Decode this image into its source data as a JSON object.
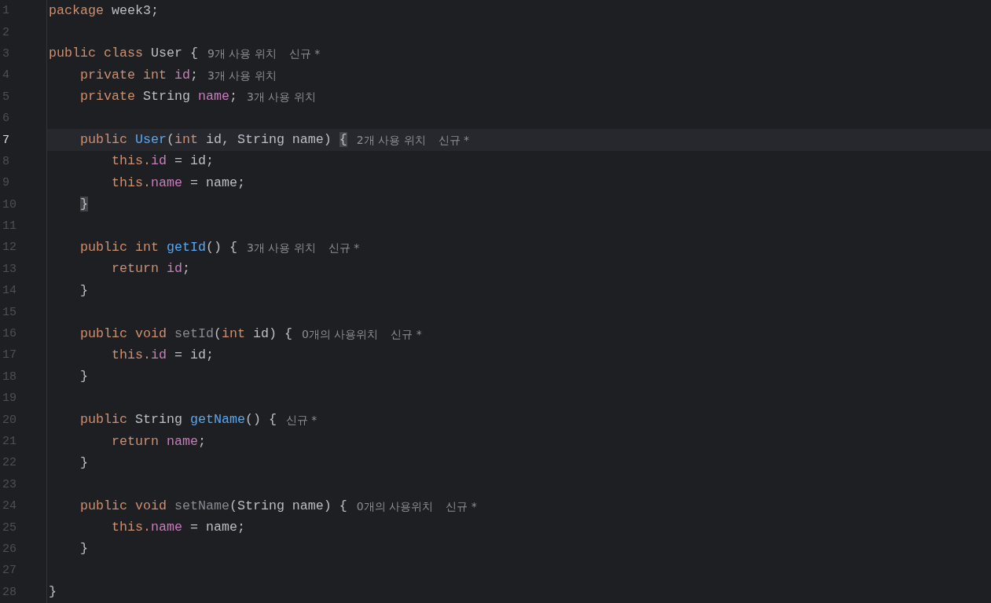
{
  "editor": {
    "lines": [
      {
        "number": "1",
        "current": false,
        "tokens": [
          {
            "kind": "keyword",
            "text": "package "
          },
          {
            "kind": "plain",
            "text": "week3;"
          }
        ]
      },
      {
        "number": "2",
        "current": false
      },
      {
        "number": "3",
        "current": false,
        "tokens": [
          {
            "kind": "keyword",
            "text": "public class "
          },
          {
            "kind": "plain",
            "text": "User {"
          }
        ],
        "hints": [
          "9개 사용 위치",
          "신규 *"
        ]
      },
      {
        "number": "4",
        "current": false,
        "tokens": [
          {
            "kind": "keyword",
            "text": "    private int "
          },
          {
            "kind": "field",
            "text": "id"
          },
          {
            "kind": "plain",
            "text": ";"
          }
        ],
        "hints": [
          "3개 사용 위치"
        ]
      },
      {
        "number": "5",
        "current": false,
        "tokens": [
          {
            "kind": "keyword",
            "text": "    private "
          },
          {
            "kind": "plain",
            "text": "String "
          },
          {
            "kind": "field",
            "text": "name"
          },
          {
            "kind": "plain",
            "text": ";"
          }
        ],
        "hints": [
          "3개 사용 위치"
        ]
      },
      {
        "number": "6",
        "current": false
      },
      {
        "number": "7",
        "current": true,
        "tokens": [
          {
            "kind": "keyword",
            "text": "    public "
          },
          {
            "kind": "method",
            "text": "User"
          },
          {
            "kind": "plain",
            "text": "("
          },
          {
            "kind": "keyword",
            "text": "int "
          },
          {
            "kind": "plain",
            "text": "id, String name) "
          },
          {
            "kind": "match",
            "text": "{"
          }
        ],
        "hints": [
          "2개 사용 위치",
          "신규 *"
        ]
      },
      {
        "number": "8",
        "current": false,
        "tokens": [
          {
            "kind": "keyword",
            "text": "        this."
          },
          {
            "kind": "field",
            "text": "id"
          },
          {
            "kind": "plain",
            "text": " = id;"
          }
        ]
      },
      {
        "number": "9",
        "current": false,
        "tokens": [
          {
            "kind": "keyword",
            "text": "        this."
          },
          {
            "kind": "field",
            "text": "name"
          },
          {
            "kind": "plain",
            "text": " = name;"
          }
        ]
      },
      {
        "number": "10",
        "current": false,
        "nested": true,
        "tokens": [
          {
            "kind": "match",
            "text": "}"
          }
        ]
      },
      {
        "number": "11",
        "current": false
      },
      {
        "number": "12",
        "current": false,
        "tokens": [
          {
            "kind": "keyword",
            "text": "    public int "
          },
          {
            "kind": "method",
            "text": "getId"
          },
          {
            "kind": "plain",
            "text": "() {"
          }
        ],
        "hints": [
          "3개 사용 위치",
          "신규 *"
        ]
      },
      {
        "number": "13",
        "current": false,
        "tokens": [
          {
            "kind": "keyword",
            "text": "        return "
          },
          {
            "kind": "field",
            "text": "id"
          },
          {
            "kind": "plain",
            "text": ";"
          }
        ]
      },
      {
        "number": "14",
        "current": false,
        "tokens": [
          {
            "kind": "plain",
            "text": "    }"
          }
        ]
      },
      {
        "number": "15",
        "current": false
      },
      {
        "number": "16",
        "current": false,
        "tokens": [
          {
            "kind": "keyword",
            "text": "    public void "
          },
          {
            "kind": "unused",
            "text": "setId"
          },
          {
            "kind": "plain",
            "text": "("
          },
          {
            "kind": "keyword",
            "text": "int "
          },
          {
            "kind": "plain",
            "text": "id) {"
          }
        ],
        "hints": [
          "0개의 사용위치",
          "신규 *"
        ]
      },
      {
        "number": "17",
        "current": false,
        "tokens": [
          {
            "kind": "keyword",
            "text": "        this."
          },
          {
            "kind": "field",
            "text": "id"
          },
          {
            "kind": "plain",
            "text": " = id;"
          }
        ]
      },
      {
        "number": "18",
        "current": false,
        "tokens": [
          {
            "kind": "plain",
            "text": "    }"
          }
        ]
      },
      {
        "number": "19",
        "current": false
      },
      {
        "number": "20",
        "current": false,
        "tokens": [
          {
            "kind": "keyword",
            "text": "    public "
          },
          {
            "kind": "plain",
            "text": "String "
          },
          {
            "kind": "method",
            "text": "getName"
          },
          {
            "kind": "plain",
            "text": "() {"
          }
        ],
        "hints": [
          "신규 *"
        ]
      },
      {
        "number": "21",
        "current": false,
        "tokens": [
          {
            "kind": "keyword",
            "text": "        return "
          },
          {
            "kind": "field",
            "text": "name"
          },
          {
            "kind": "plain",
            "text": ";"
          }
        ]
      },
      {
        "number": "22",
        "current": false,
        "tokens": [
          {
            "kind": "plain",
            "text": "    }"
          }
        ]
      },
      {
        "number": "23",
        "current": false
      },
      {
        "number": "24",
        "current": false,
        "tokens": [
          {
            "kind": "keyword",
            "text": "    public void "
          },
          {
            "kind": "unused",
            "text": "setName"
          },
          {
            "kind": "plain",
            "text": "(String name) {"
          }
        ],
        "hints": [
          "0개의 사용위치",
          "신규 *"
        ]
      },
      {
        "number": "25",
        "current": false,
        "tokens": [
          {
            "kind": "keyword",
            "text": "        this."
          },
          {
            "kind": "field",
            "text": "name"
          },
          {
            "kind": "plain",
            "text": " = name;"
          }
        ]
      },
      {
        "number": "26",
        "current": false,
        "tokens": [
          {
            "kind": "plain",
            "text": "    }"
          }
        ]
      },
      {
        "number": "27",
        "current": false
      },
      {
        "number": "28",
        "current": false,
        "tokens": [
          {
            "kind": "plain",
            "text": "}"
          }
        ]
      }
    ]
  }
}
